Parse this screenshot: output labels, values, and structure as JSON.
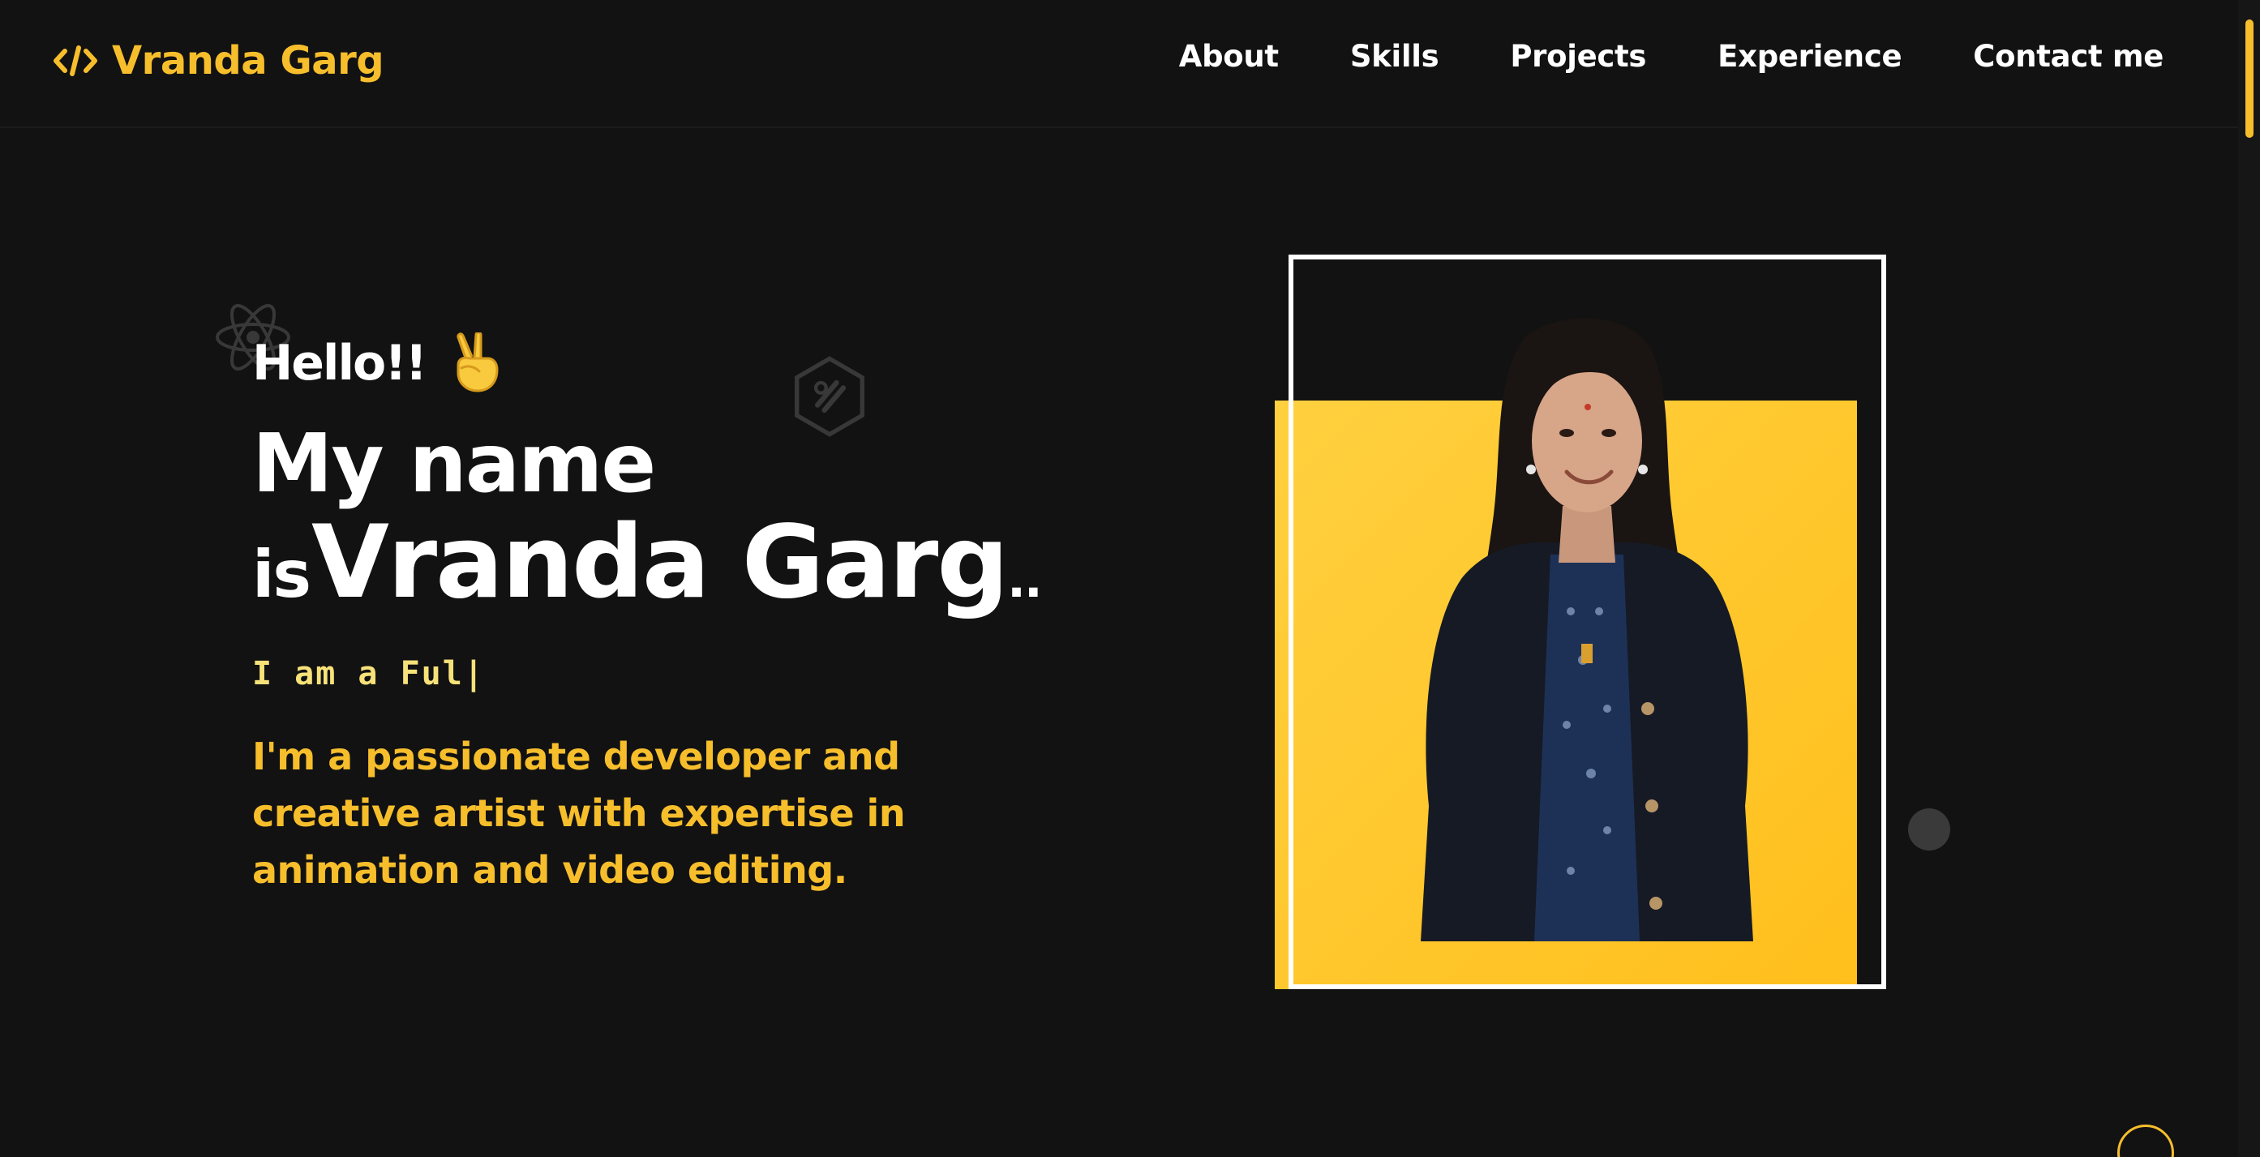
{
  "brand": {
    "name": "Vranda Garg",
    "icon": "code-icon"
  },
  "nav": {
    "items": [
      {
        "label": "About"
      },
      {
        "label": "Skills"
      },
      {
        "label": "Projects"
      },
      {
        "label": "Experience"
      },
      {
        "label": "Contact me"
      }
    ]
  },
  "hero": {
    "greeting": "Hello!!",
    "greeting_icon": "victory-hand-icon",
    "line1": "My name",
    "line2_prefix": "is",
    "line2_name": "Vranda Garg",
    "line2_suffix": "..",
    "typed_text": "I am a Ful|",
    "bio": "I'm a passionate developer and creative artist with expertise in animation and video editing."
  },
  "decorations": {
    "left": "react-atom-icon",
    "right": "hexagon-logo-icon"
  },
  "colors": {
    "background": "#121212",
    "accent": "#f7be2c",
    "typed": "#f7e27a",
    "text": "#ffffff"
  }
}
